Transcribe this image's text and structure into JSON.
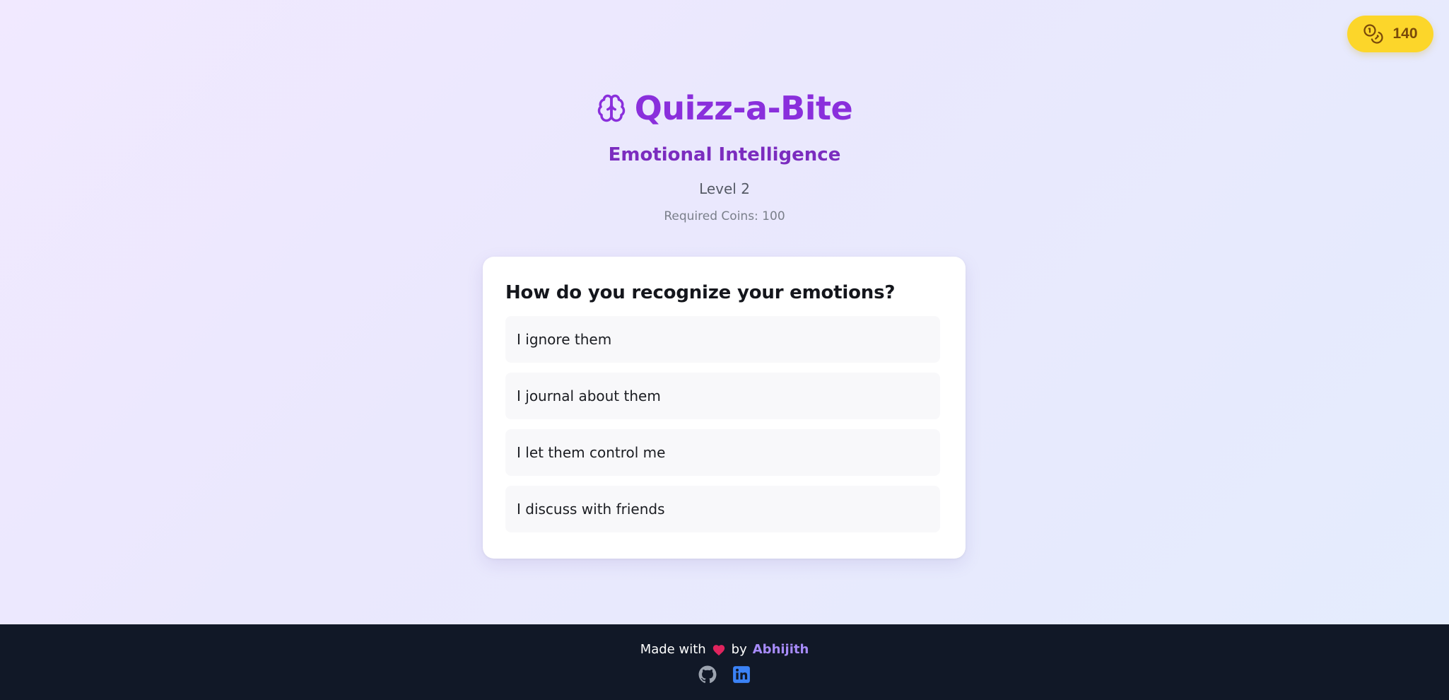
{
  "coins": {
    "icon": "coins-icon",
    "count": "140"
  },
  "header": {
    "icon": "brain-icon",
    "title": "Quizz-a-Bite",
    "category": "Emotional Intelligence",
    "level": "Level 2",
    "required_coins": "Required Coins: 100"
  },
  "quiz": {
    "question": "How do you recognize your emotions?",
    "options": [
      "I ignore them",
      "I journal about them",
      "I let them control me",
      "I discuss with friends"
    ]
  },
  "footer": {
    "made_with": "Made with",
    "heart_icon": "heart-icon",
    "by": "by",
    "author": "Abhijith",
    "social": [
      "github-icon",
      "linkedin-icon"
    ]
  },
  "colors": {
    "accent": "#8a2fdc",
    "coin_badge": "#fcd62a",
    "footer_bg": "#111827",
    "author_link": "#a78bfa",
    "heart": "#e0245e"
  }
}
